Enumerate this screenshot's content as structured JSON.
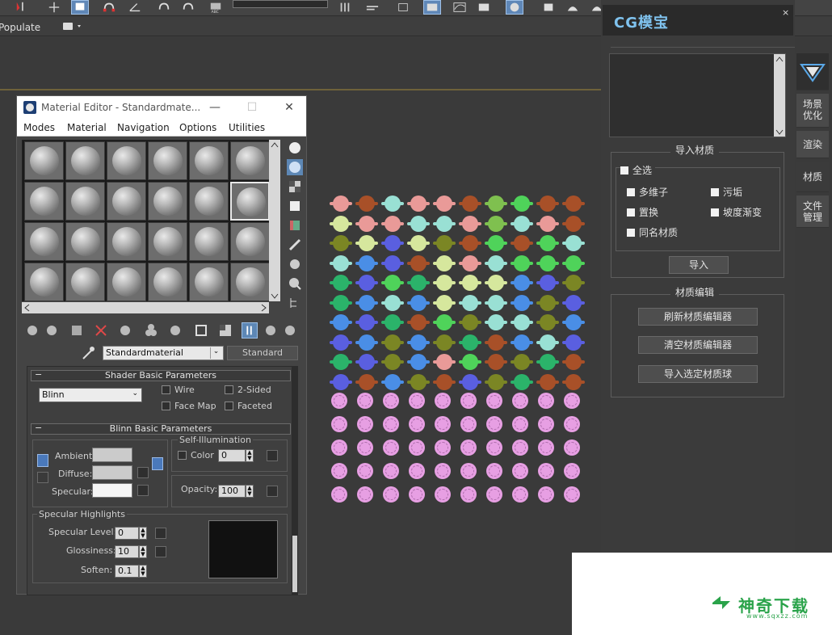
{
  "toolbar": {
    "select_value": "",
    "populate_label": "Populate"
  },
  "material_editor": {
    "title": "Material Editor - Standardmate...",
    "menu": [
      "Modes",
      "Material",
      "Navigation",
      "Options",
      "Utilities"
    ],
    "material_name": "Standardmaterial",
    "material_type": "Standard",
    "shader_rollout": {
      "title": "Shader Basic Parameters",
      "shader": "Blinn",
      "wire": "Wire",
      "two_sided": "2-Sided",
      "face_map": "Face Map",
      "faceted": "Faceted"
    },
    "blinn_rollout": {
      "title": "Blinn Basic Parameters",
      "ambient": "Ambient:",
      "diffuse": "Diffuse:",
      "specular": "Specular:",
      "self_illum": "Self-Illumination",
      "color": "Color",
      "color_value": "0",
      "opacity": "Opacity:",
      "opacity_value": "100"
    },
    "spec_highlights": {
      "title": "Specular Highlights",
      "level_label": "Specular Level:",
      "level_value": "0",
      "gloss_label": "Glossiness:",
      "gloss_value": "10",
      "soften_label": "Soften:",
      "soften_value": "0.1"
    }
  },
  "cg_panel": {
    "logo": "CG模宝",
    "close": "×",
    "import_group": "导入材质",
    "select_all": "全选",
    "options": [
      "多维子",
      "污垢",
      "置换",
      "坡度渐变",
      "同名材质"
    ],
    "import_button": "导入",
    "edit_group": "材质编辑",
    "buttons": [
      "刷新材质编辑器",
      "清空材质编辑器",
      "导入选定材质球"
    ],
    "tabs": [
      "场景优化",
      "渲染",
      "材质",
      "文件管理"
    ]
  },
  "watermark": {
    "text": "神奇下载",
    "url": "www.sqxzz.com"
  },
  "sphere_colors": {
    "striped_rows": [
      [
        "#e99a98",
        "#a85028",
        "#99e0d4",
        "#e99a98",
        "#e99a98",
        "#a85028",
        "#7fc04f",
        "#4fd35a",
        "#a85028",
        "#a85028"
      ],
      [
        "#d6e79d",
        "#e99a98",
        "#e99a98",
        "#99e0d4",
        "#99e0d4",
        "#e99a98",
        "#7fc04f",
        "#99e0d4",
        "#e99a98",
        "#a85028"
      ],
      [
        "#7b8624",
        "#d6e79d",
        "#5a5fe0",
        "#d6e79d",
        "#7b8624",
        "#a85028",
        "#4fd35a",
        "#a85028",
        "#4fd35a",
        "#99e0d4"
      ],
      [
        "#99e0d4",
        "#4a8ee6",
        "#5a5fe0",
        "#a85028",
        "#d6e79d",
        "#e99a98",
        "#99e0d4",
        "#4fd35a",
        "#4fd35a",
        "#4fd35a"
      ],
      [
        "#2bb36a",
        "#5a5fe0",
        "#4fd35a",
        "#2bb36a",
        "#d6e79d",
        "#d6e79d",
        "#d6e79d",
        "#4a8ee6",
        "#5a5fe0",
        "#7b8624"
      ],
      [
        "#2bb36a",
        "#4a8ee6",
        "#99e0d4",
        "#4a8ee6",
        "#d6e79d",
        "#99e0d4",
        "#99e0d4",
        "#4a8ee6",
        "#7b8624",
        "#5a5fe0"
      ],
      [
        "#4a8ee6",
        "#5a5fe0",
        "#2bb36a",
        "#a85028",
        "#4fd35a",
        "#7b8624",
        "#99e0d4",
        "#99e0d4",
        "#7b8624",
        "#4a8ee6"
      ],
      [
        "#5a5fe0",
        "#4a8ee6",
        "#7b8624",
        "#4a8ee6",
        "#7b8624",
        "#2bb36a",
        "#a85028",
        "#4a8ee6",
        "#99e0d4",
        "#5a5fe0"
      ],
      [
        "#2bb36a",
        "#5a5fe0",
        "#7b8624",
        "#4a8ee6",
        "#e99a98",
        "#4fd35a",
        "#a85028",
        "#7b8624",
        "#2bb36a",
        "#a85028"
      ],
      [
        "#5a5fe0",
        "#a85028",
        "#4a8ee6",
        "#7b8624",
        "#a85028",
        "#5a5fe0",
        "#7b8624",
        "#2bb36a",
        "#a85028",
        "#a85028"
      ]
    ],
    "dotted_rows": 5
  }
}
